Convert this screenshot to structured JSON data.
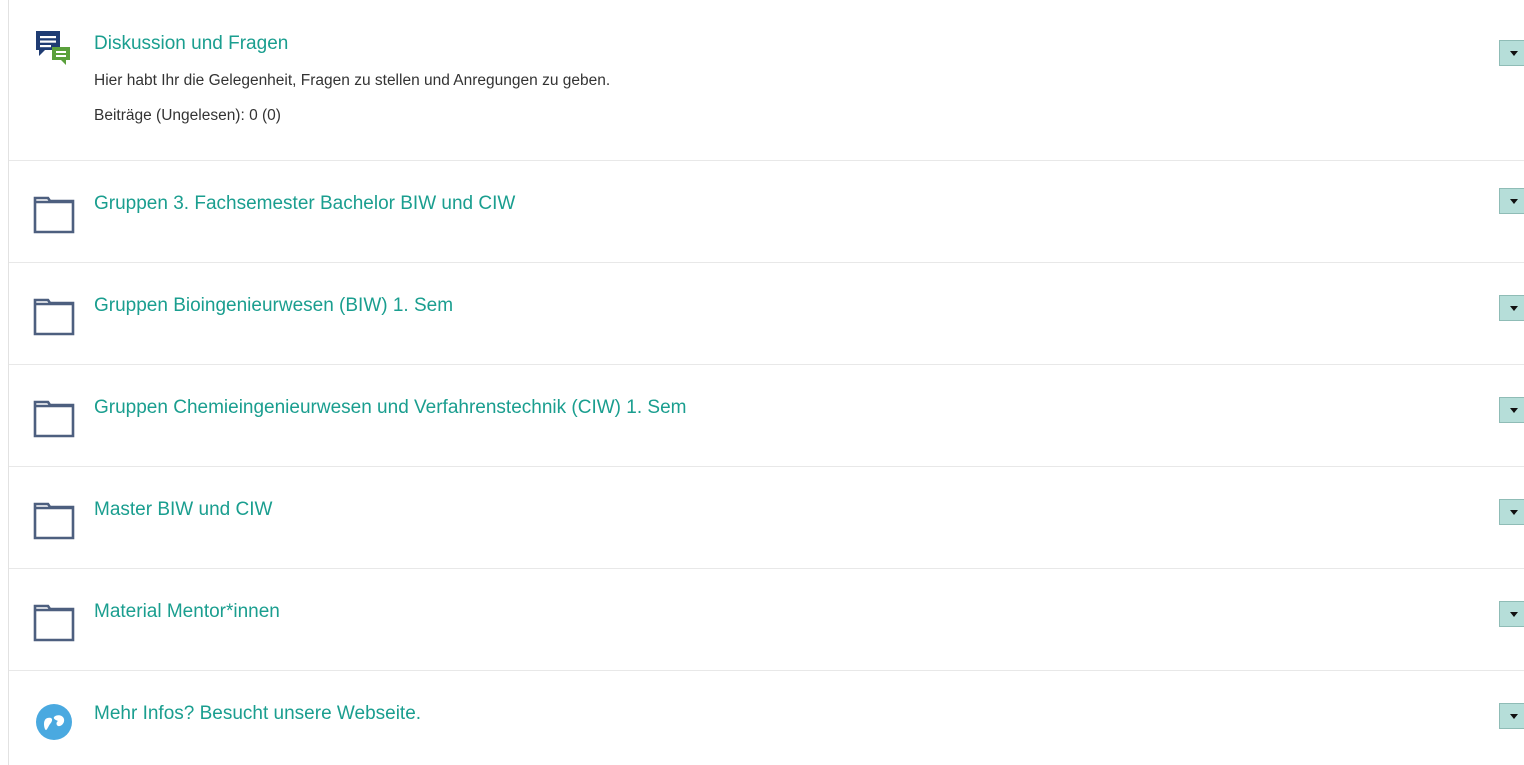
{
  "items": [
    {
      "title": "Diskussion und Fragen",
      "description": "Hier habt Ihr die Gelegenheit, Fragen zu stellen und Anregungen zu geben.",
      "meta": "Beiträge (Ungelesen): 0 (0)",
      "icon": "forum-icon"
    },
    {
      "title": "Gruppen 3. Fachsemester Bachelor BIW und CIW",
      "icon": "folder-icon"
    },
    {
      "title": "Gruppen Bioingenieurwesen (BIW) 1. Sem",
      "icon": "folder-icon"
    },
    {
      "title": "Gruppen Chemieingenieurwesen und Verfahrenstechnik (CIW) 1. Sem",
      "icon": "folder-icon"
    },
    {
      "title": "Master BIW und CIW",
      "icon": "folder-icon"
    },
    {
      "title": "Material Mentor*innen",
      "icon": "folder-icon"
    },
    {
      "title": "Mehr Infos? Besucht unsere Webseite.",
      "icon": "weblink-icon"
    }
  ],
  "colors": {
    "link": "#1a9e8f",
    "toggle_bg": "#b6ded9",
    "folder": "#4d5f7f",
    "forum_bubble_blue": "#1f3c73",
    "forum_bubble_green": "#5aa03c",
    "weblink_circle": "#4aa9e0"
  }
}
